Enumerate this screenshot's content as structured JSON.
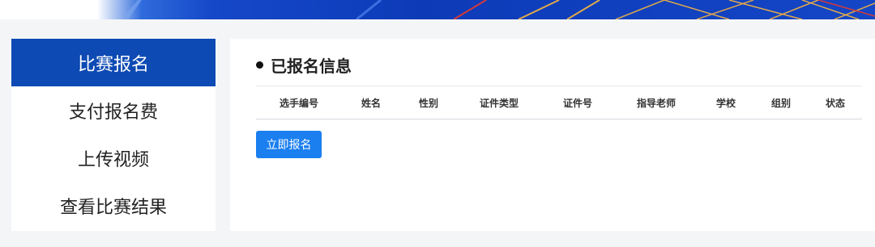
{
  "sidebar": {
    "items": [
      {
        "label": "比赛报名"
      },
      {
        "label": "支付报名费"
      },
      {
        "label": "上传视频"
      },
      {
        "label": "查看比赛结果"
      }
    ]
  },
  "main": {
    "title": "已报名信息",
    "table": {
      "columns": [
        "选手编号",
        "姓名",
        "性别",
        "证件类型",
        "证件号",
        "指导老师",
        "学校",
        "组别",
        "状态"
      ]
    },
    "register_button": "立即报名"
  },
  "colors": {
    "banner_blue": "#0d3bb8",
    "sidebar_active": "#0d4ab4",
    "button_blue": "#1b7ff0"
  }
}
